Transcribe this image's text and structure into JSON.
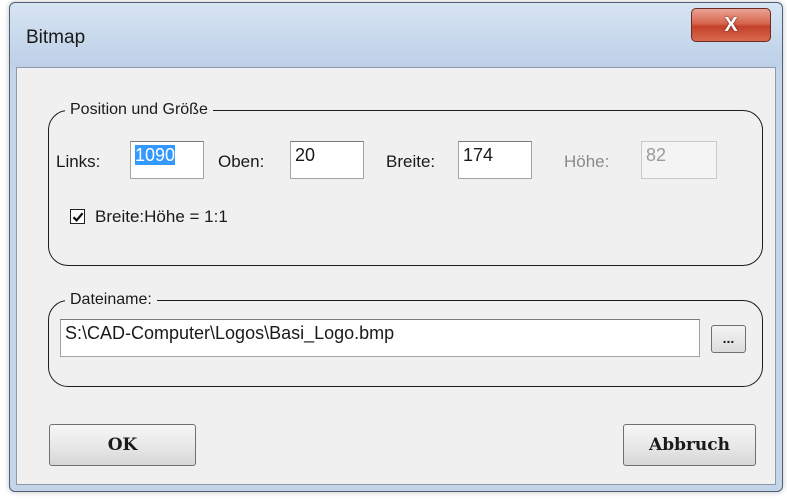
{
  "window": {
    "title": "Bitmap",
    "close_glyph": "X"
  },
  "position_group": {
    "label": "Position und Größe",
    "links_label": "Links:",
    "links_value": "1090",
    "oben_label": "Oben:",
    "oben_value": "20",
    "breite_label": "Breite:",
    "breite_value": "174",
    "hoehe_label": "Höhe:",
    "hoehe_value": "82",
    "aspect_checkbox_label": "Breite:Höhe = 1:1",
    "aspect_checked": true
  },
  "file_group": {
    "label": "Dateiname:",
    "path_value": "S:\\CAD-Computer\\Logos\\Basi_Logo.bmp",
    "browse_label": "..."
  },
  "buttons": {
    "ok_label": "OK",
    "cancel_label": "Abbruch"
  },
  "colors": {
    "selection": "#3399ff",
    "close_button": "#c4402a",
    "frame": "#c4d5e9"
  }
}
